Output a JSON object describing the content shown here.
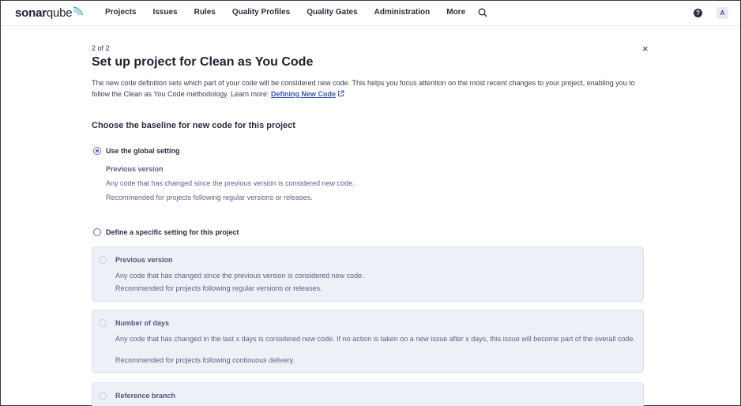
{
  "nav": {
    "logo_main": "sonar",
    "logo_sub": "qube",
    "items": [
      "Projects",
      "Issues",
      "Rules",
      "Quality Profiles",
      "Quality Gates",
      "Administration",
      "More"
    ],
    "help_glyph": "?",
    "avatar_initial": "A"
  },
  "page": {
    "step": "2 of 2",
    "title": "Set up project for Clean as You Code",
    "description": "The new code definition sets which part of your code will be considered new code. This helps you focus attention on the most recent changes to your project, enabling you to follow the Clean as You Code methodology. Learn more:",
    "learn_more_link": "Defining New Code",
    "section_title": "Choose the baseline for new code for this project",
    "close_glyph": "×"
  },
  "global_setting": {
    "label": "Use the global setting",
    "selected": true,
    "option_title": "Previous version",
    "line1": "Any code that has changed since the previous version is considered new code.",
    "line2": "Recommended for projects following regular versions or releases."
  },
  "specific_setting": {
    "label": "Define a specific setting for this project",
    "selected": false,
    "options": [
      {
        "title": "Previous version",
        "line1": "Any code that has changed since the previous version is considered new code.",
        "line2": "Recommended for projects following regular versions or releases."
      },
      {
        "title": "Number of days",
        "line1": "Any code that has changed in the last x days is considered new code. If no action is taken on a new issue after x days, this issue will become part of the overall code.",
        "line2": "Recommended for projects following continuous delivery."
      },
      {
        "title": "Reference branch"
      }
    ]
  },
  "colors": {
    "accent": "#5d6cd0",
    "link": "#3e55a8",
    "card_bg": "#eef0f7"
  }
}
